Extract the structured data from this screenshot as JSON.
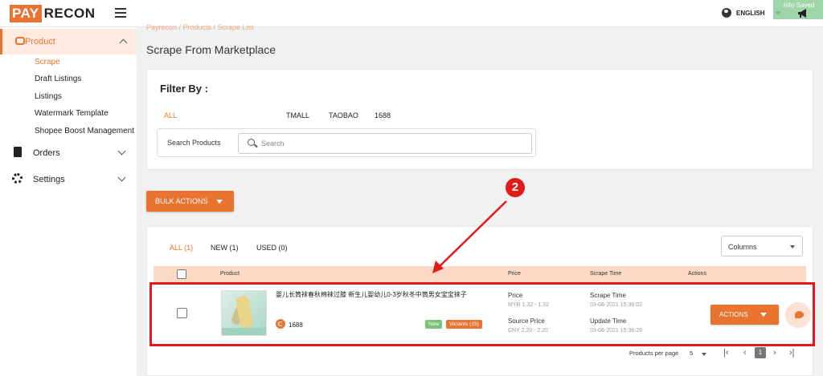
{
  "app": {
    "logo_pay": "PAY",
    "logo_recon": "RECON",
    "language": "ENGLISH",
    "notification_label": "Info Saved"
  },
  "sidebar": {
    "product_label": "Product",
    "sub_items": [
      "Scrape",
      "Draft Listings",
      "Listings",
      "Watermark Template",
      "Shopee Boost Management"
    ],
    "orders_label": "Orders",
    "settings_label": "Settings"
  },
  "breadcrumb": "Payrecon  /  Products  /  Scrape List",
  "page_title": "Scrape From Marketplace",
  "filter": {
    "title": "Filter By :",
    "tabs": [
      "ALL",
      "TMALL",
      "TAOBAO",
      "1688"
    ],
    "search_label": "Search Products",
    "search_placeholder": "Search"
  },
  "bulk_actions_label": "BULK ACTIONS",
  "table": {
    "condition_tabs": [
      "ALL (1)",
      "NEW (1)",
      "USED (0)"
    ],
    "columns_label": "Columns",
    "headers": {
      "product": "Product",
      "price": "Price",
      "scrape_time": "Scrape Time",
      "actions": "Actions"
    },
    "row": {
      "name": "婴儿长筒袜春秋棉袜过膝 新生儿婴幼儿0-3岁秋冬中筒男女宝宝袜子",
      "marketplace": "1688",
      "badge_new": "New",
      "badge_variants": "Variants (15)",
      "price_label": "Price",
      "price_value": "MYR 1.32 - 1.32",
      "source_price_label": "Source Price",
      "source_price_value": "CNY 2.20 - 2.20",
      "scrape_time_label": "Scrape Time",
      "scrape_time_value": "03-08-2021 15:36:02",
      "update_time_label": "Update Time",
      "update_time_value": "03-08-2021 15:36:26",
      "actions_label": "ACTIONS"
    }
  },
  "pagination": {
    "per_page_label": "Products per page",
    "per_page_value": "5",
    "current_page": "1"
  },
  "annotation": {
    "step_number": "2"
  },
  "colors": {
    "accent": "#e8742f",
    "highlight": "#e11a1a",
    "header_row": "#fcdac6"
  }
}
